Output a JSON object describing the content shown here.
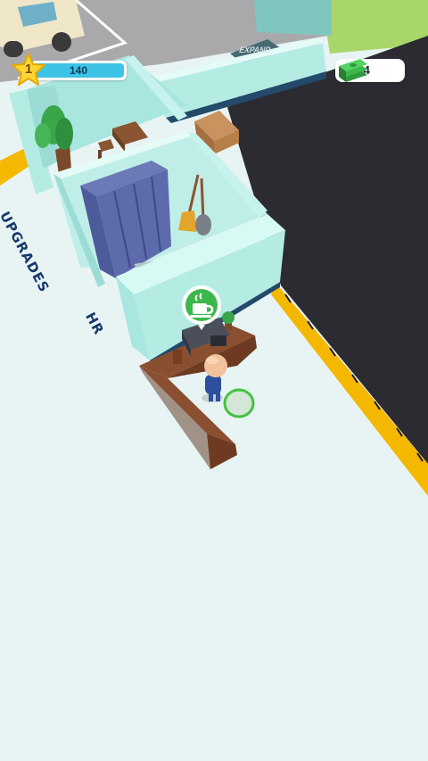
{
  "hud": {
    "level": "1",
    "xp_label": "140",
    "xp_progress": 1.0,
    "cash": "244"
  },
  "floor_labels": {
    "upgrades": "UPGRADES",
    "hr": "HR"
  },
  "signs": {
    "expand": "EXPAND"
  },
  "icons": {
    "level": "star-icon",
    "cash": "cash-stack-icon",
    "task": "coffee-cup-icon"
  },
  "colors": {
    "floor": "#e8f4f3",
    "wall": "#a8e6df",
    "dark_area": "#2a2a30",
    "hazard_stripe": "#f5b800",
    "xp_bar": "#3dc3e6",
    "task_badge": "#3bb84a",
    "label_text": "#17386b"
  }
}
